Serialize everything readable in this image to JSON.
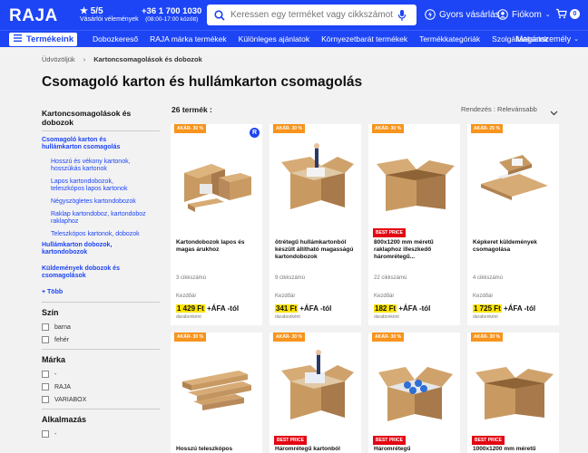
{
  "header": {
    "logo": "RAJA",
    "rating": "5/5",
    "rating_sub": "Vásárlói vélemények",
    "phone": "+36 1 700 1030",
    "phone_hours": "(08:00-17:00 között)",
    "search_placeholder": "Keressen egy terméket vagy cikkszámot",
    "quick_order": "Gyors vásárlás",
    "account": "Fiókom",
    "cart_count": "0"
  },
  "nav": {
    "products": "Termékeink",
    "items": [
      "Dobozkereső",
      "RAJA márka termékek",
      "Különleges ajánlatok",
      "Környezetbarát termékek",
      "Termékkategóriák",
      "Szolgáltatásaink"
    ],
    "personal": "Magánszemély"
  },
  "breadcrumb": {
    "home": "Üdvözöljük",
    "current": "Kartoncsomagolások és dobozok"
  },
  "page_title": "Csomagoló karton és hullámkarton csomagolás",
  "sidebar": {
    "category_title": "Kartoncsomagolások és dobozok",
    "active": "Csomagoló karton és hullámkarton csomagolás",
    "subitems": [
      "Hosszú és vékony kartonok, hosszúkás kartonok",
      "Lapos kartondobozok, teleszkópos lapos kartonok",
      "Négyszögletes kartondobozok",
      "Raklap kartondoboz, kartondoboz raklaphoz",
      "Teleszkópos kartonok, dobozok"
    ],
    "other1": "Hullámkarton dobozok, kartondobozok",
    "other2": "Küldemények dobozok és csomagolások",
    "more": "+ Több",
    "color_title": "Szín",
    "colors": [
      "barna",
      "fehér"
    ],
    "brand_title": "Márka",
    "brands": [
      "-",
      "RAJA",
      "VARIABOX"
    ],
    "alk_title": "Alkalmazás",
    "alk": [
      "-"
    ]
  },
  "results": {
    "count": "26 termék :",
    "sort": "Rendezés : Relevánsabb"
  },
  "products": [
    {
      "discount": "AKÁR- 30 %",
      "name": "Kartondobozok lapos és magas árukhoz",
      "variants": "3 cikkszámú",
      "start": "Kezdőár",
      "price_hl": "1 429 Ft",
      "price_rest": " +ÁFA -tól",
      "unit": "darabonként",
      "bestprice": ""
    },
    {
      "discount": "AKÁR- 30 %",
      "name": "ötrétegű hullámkartonból készült állítható magasságú kartondobozok",
      "variants": "9 cikkszámú",
      "start": "Kezdőár",
      "price_hl": "341 Ft",
      "price_rest": " +ÁFA -tól",
      "unit": "darabonként",
      "bestprice": ""
    },
    {
      "discount": "AKÁR- 30 %",
      "name": "800x1200 mm méretű raklaphoz illeszkedő háromrétegű...",
      "variants": "22 cikkszámú",
      "start": "Kezdőár",
      "price_hl": "182 Ft",
      "price_rest": " +ÁFA -tól",
      "unit": "darabonként",
      "bestprice": "BEST PRICE"
    },
    {
      "discount": "AKÁR- 25 %",
      "name": "Képkeret küldemények csomagolása",
      "variants": "4 cikkszámú",
      "start": "Kezdőár",
      "price_hl": "1 725 Ft",
      "price_rest": " +ÁFA -tól",
      "unit": "darabonként",
      "bestprice": ""
    },
    {
      "discount": "AKÁR- 30 %",
      "name": "Hosszú teleszkópos",
      "bestprice": ""
    },
    {
      "discount": "AKÁR- 30 %",
      "name": "Háromrétegű kartonból",
      "bestprice": "BEST PRICE"
    },
    {
      "discount": "AKÁR- 30 %",
      "name": "Háromrétegű",
      "bestprice": "BEST PRICE"
    },
    {
      "discount": "AKÁR- 30 %",
      "name": "1000x1200 mm méretű",
      "bestprice": "BEST PRICE"
    }
  ],
  "colors": {
    "brand_blue": "#1d45f5",
    "discount": "#f7941d",
    "best_price": "#e30613",
    "highlight": "#ffe400"
  }
}
